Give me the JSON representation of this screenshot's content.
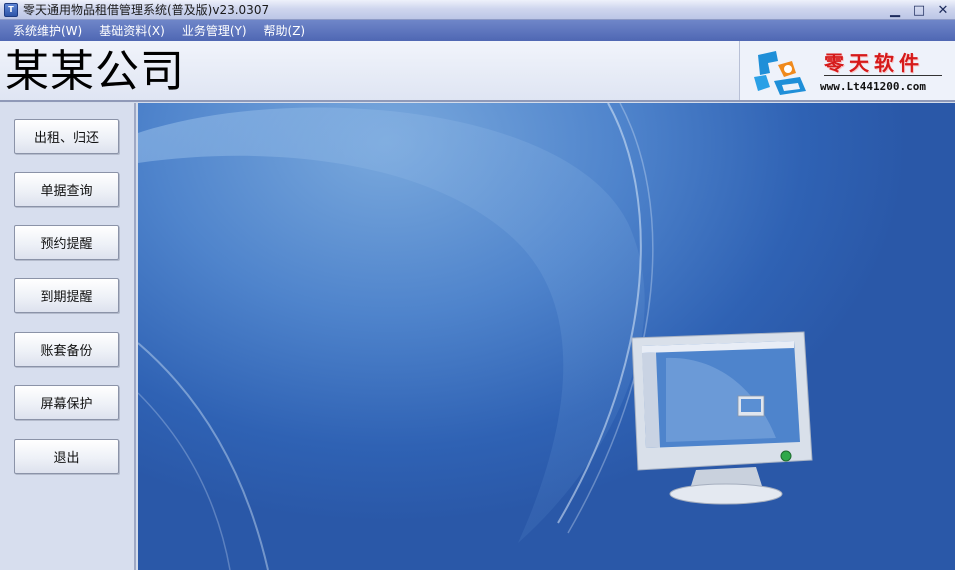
{
  "window": {
    "title": "零天通用物品租借管理系统(普及版)v23.0307",
    "minimize_glyph": "▁",
    "maximize_glyph": "□",
    "close_glyph": "✕"
  },
  "menu": [
    {
      "label": "系统维护(W)"
    },
    {
      "label": "基础资料(X)"
    },
    {
      "label": "业务管理(Y)"
    },
    {
      "label": "帮助(Z)"
    }
  ],
  "header": {
    "company": "某某公司",
    "logo": {
      "name": "零天软件",
      "url": "www.Lt441200.com"
    }
  },
  "sidebar": [
    {
      "label": "出租、归还"
    },
    {
      "label": "单据查询"
    },
    {
      "label": "预约提醒"
    },
    {
      "label": "到期提醒"
    },
    {
      "label": "账套备份"
    },
    {
      "label": "屏幕保护"
    },
    {
      "label": "退出"
    }
  ],
  "colors": {
    "menubar": "#5a72bd",
    "desktop": "#2f62b4",
    "logo_red": "#d61a1a",
    "logo_blue": "#1f8fd8"
  }
}
